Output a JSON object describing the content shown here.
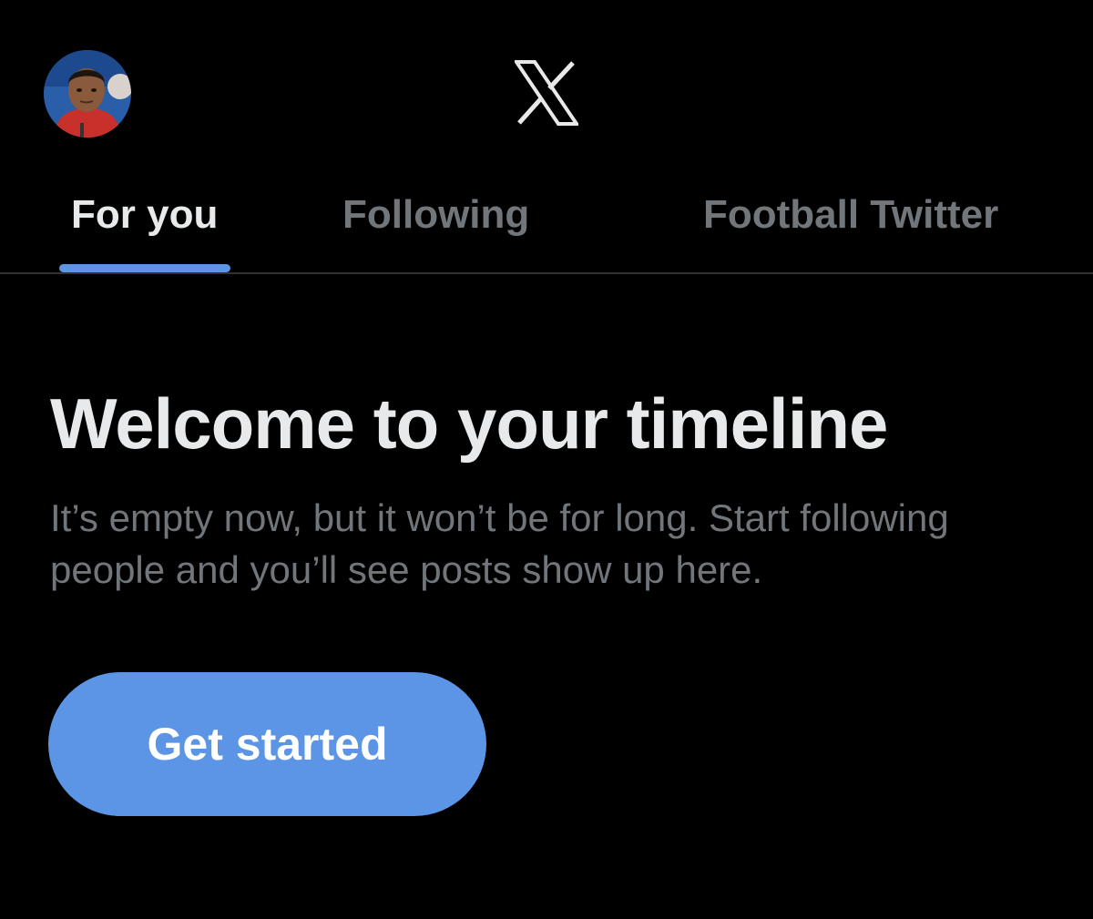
{
  "header": {
    "avatar_icon": "profile-photo-avatar",
    "logo_icon": "x-logo-icon"
  },
  "tabs": [
    {
      "label": "For you",
      "active": true
    },
    {
      "label": "Following",
      "active": false
    },
    {
      "label": "Football Twitter",
      "active": false
    }
  ],
  "main": {
    "headline": "Welcome to your timeline",
    "subtext": "It’s empty now, but it won’t be for long. Start following people and you’ll see posts show up here.",
    "cta_label": "Get started"
  },
  "colors": {
    "background": "#000000",
    "primary_text": "#e7e9ea",
    "secondary_text": "#71767b",
    "accent": "#5c95e5",
    "divider": "#2f3336"
  }
}
